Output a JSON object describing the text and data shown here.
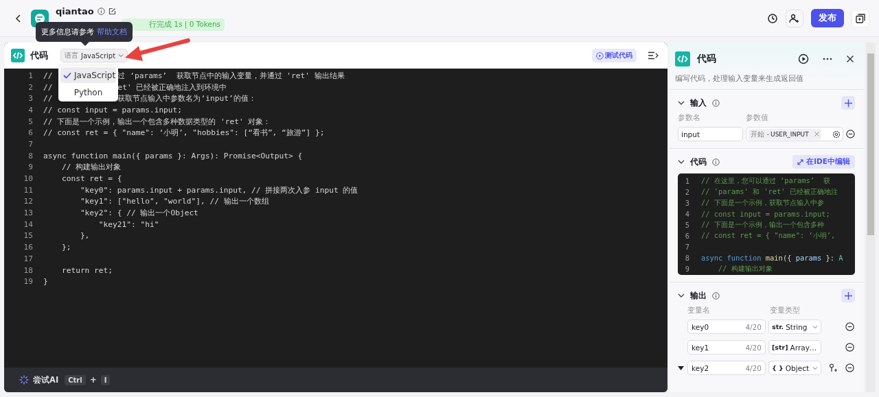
{
  "header": {
    "app_name": "qiantao",
    "status": "行完成 1s | 0 Tokens",
    "tooltip": {
      "text": "更多信息请参考",
      "link": "帮助文档"
    },
    "publish_button": "发布"
  },
  "editor": {
    "title": "代码",
    "language_label": "语言",
    "language": "JavaScript",
    "test_button": "测试代码",
    "language_menu": [
      {
        "label": "JavaScript",
        "selected": true
      },
      {
        "label": "Python",
        "selected": false
      }
    ],
    "lines": [
      {
        "number": "1",
        "text": "//",
        "rest": "过 ‘params’  获取节点中的输入变量，并通过 'ret' 输出结果"
      },
      {
        "number": "2",
        "text": "//",
        "rest": "et' 已经被正确地注入到环境中"
      },
      {
        "number": "3",
        "text": "//",
        "rest": "获取节点输入中参数名为‘input’的值："
      },
      {
        "number": "4",
        "text": "// const input = params.input;"
      },
      {
        "number": "5",
        "text": "// 下面是一个示例，输出一个包含多种数据类型的 'ret' 对象："
      },
      {
        "number": "6",
        "text": "// const ret = { \"name\": ‘小明’, \"hobbies\": [“看书”, “旅游”] };"
      },
      {
        "number": "7"
      },
      {
        "number": "8",
        "text": "async function main({ params }: Args): Promise<Output> {"
      },
      {
        "number": "9",
        "text": "    // 构建输出对象"
      },
      {
        "number": "10",
        "text": "    const ret = {"
      },
      {
        "number": "11",
        "text": "        \"key0\": params.input + params.input, // 拼接两次入参 input 的值"
      },
      {
        "number": "12",
        "text": "        \"key1\": [\"hello\", \"world\"], // 输出一个数组"
      },
      {
        "number": "13",
        "text": "        \"key2\": { // 输出一个Object"
      },
      {
        "number": "14",
        "text": "            \"key21\": \"hi\""
      },
      {
        "number": "15",
        "text": "        },"
      },
      {
        "number": "16",
        "text": "    };"
      },
      {
        "number": "17"
      },
      {
        "number": "18",
        "text": "    return ret;"
      },
      {
        "number": "19",
        "text": "}"
      }
    ],
    "ai_bar": {
      "label": "尝试AI",
      "keys": [
        "Ctrl",
        "I"
      ],
      "plus": "+"
    }
  },
  "panel": {
    "title": "代码",
    "description": "编写代码，处理输入变量来生成返回值",
    "input": {
      "title": "输入",
      "name_label": "参数名",
      "value_label": "参数值",
      "rows": [
        {
          "name": "input",
          "source": "开始 -",
          "variable": "USER_INPUT"
        }
      ]
    },
    "code": {
      "title": "代码",
      "ide_button": "在IDE中编辑",
      "lines": [
        {
          "number": "1",
          "tokens": [
            {
              "text": "// 在这里，您可以通过 ‘params’  获",
              "kind": "comment"
            }
          ]
        },
        {
          "number": "2",
          "tokens": [
            {
              "text": "// 'params' 和 'ret' 已经被正确地注",
              "kind": "comment"
            }
          ]
        },
        {
          "number": "3",
          "tokens": [
            {
              "text": "// 下面是一个示例，获取节点输入中参",
              "kind": "comment"
            }
          ]
        },
        {
          "number": "4",
          "tokens": [
            {
              "text": "// const input = params.input;",
              "kind": "comment"
            }
          ]
        },
        {
          "number": "5",
          "tokens": [
            {
              "text": "// 下面是一个示例，输出一个包含多种",
              "kind": "comment"
            }
          ]
        },
        {
          "number": "6",
          "tokens": [
            {
              "text": "// const ret = { \"name\": ‘小明’, ",
              "kind": "comment"
            }
          ]
        },
        {
          "number": "7"
        },
        {
          "number": "8",
          "tokens": [
            {
              "text": "async function ",
              "kind": "keyword"
            },
            {
              "text": "main",
              "kind": "function"
            },
            {
              "text": "({ ",
              "kind": "plain"
            },
            {
              "text": "params",
              "kind": "variable"
            },
            {
              "text": " }: ",
              "kind": "plain"
            },
            {
              "text": "A",
              "kind": "type"
            }
          ]
        },
        {
          "number": "9",
          "tokens": [
            {
              "text": "    // 构建输出对象",
              "kind": "comment"
            }
          ]
        }
      ]
    },
    "output": {
      "title": "输出",
      "name_label": "变量名",
      "type_label": "变量类型",
      "rows": [
        {
          "name": "key0",
          "count": "4/20",
          "type_icon": "str.",
          "type": "String",
          "expandable": false
        },
        {
          "name": "key1",
          "count": "4/20",
          "type_icon": "[str]",
          "type": "Array…",
          "expandable": false
        },
        {
          "name": "key2",
          "count": "4/20",
          "type_icon": "{ }",
          "type": "Object",
          "expandable": true
        }
      ]
    }
  }
}
